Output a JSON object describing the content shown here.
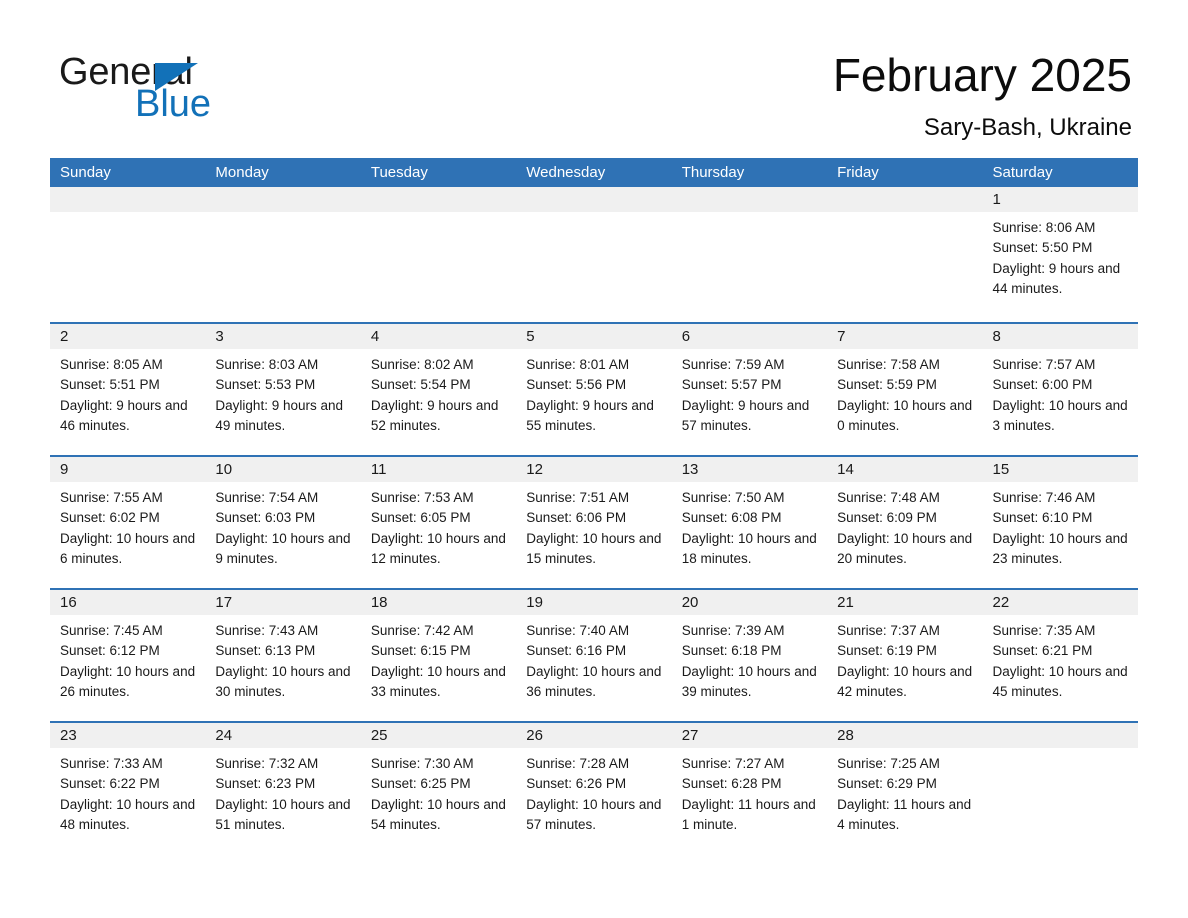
{
  "brand": {
    "name_part1": "General",
    "name_part2": "Blue",
    "accent_color": "#1271b8"
  },
  "header": {
    "month_title": "February 2025",
    "location": "Sary-Bash, Ukraine"
  },
  "calendar": {
    "header_bg_color": "#2f72b5",
    "day_band_color": "#f0f0f0",
    "day_names": [
      "Sunday",
      "Monday",
      "Tuesday",
      "Wednesday",
      "Thursday",
      "Friday",
      "Saturday"
    ],
    "weeks": [
      [
        {
          "day": "",
          "empty": true
        },
        {
          "day": "",
          "empty": true
        },
        {
          "day": "",
          "empty": true
        },
        {
          "day": "",
          "empty": true
        },
        {
          "day": "",
          "empty": true
        },
        {
          "day": "",
          "empty": true
        },
        {
          "day": "1",
          "sunrise": "Sunrise: 8:06 AM",
          "sunset": "Sunset: 5:50 PM",
          "daylight": "Daylight: 9 hours and 44 minutes."
        }
      ],
      [
        {
          "day": "2",
          "sunrise": "Sunrise: 8:05 AM",
          "sunset": "Sunset: 5:51 PM",
          "daylight": "Daylight: 9 hours and 46 minutes."
        },
        {
          "day": "3",
          "sunrise": "Sunrise: 8:03 AM",
          "sunset": "Sunset: 5:53 PM",
          "daylight": "Daylight: 9 hours and 49 minutes."
        },
        {
          "day": "4",
          "sunrise": "Sunrise: 8:02 AM",
          "sunset": "Sunset: 5:54 PM",
          "daylight": "Daylight: 9 hours and 52 minutes."
        },
        {
          "day": "5",
          "sunrise": "Sunrise: 8:01 AM",
          "sunset": "Sunset: 5:56 PM",
          "daylight": "Daylight: 9 hours and 55 minutes."
        },
        {
          "day": "6",
          "sunrise": "Sunrise: 7:59 AM",
          "sunset": "Sunset: 5:57 PM",
          "daylight": "Daylight: 9 hours and 57 minutes."
        },
        {
          "day": "7",
          "sunrise": "Sunrise: 7:58 AM",
          "sunset": "Sunset: 5:59 PM",
          "daylight": "Daylight: 10 hours and 0 minutes."
        },
        {
          "day": "8",
          "sunrise": "Sunrise: 7:57 AM",
          "sunset": "Sunset: 6:00 PM",
          "daylight": "Daylight: 10 hours and 3 minutes."
        }
      ],
      [
        {
          "day": "9",
          "sunrise": "Sunrise: 7:55 AM",
          "sunset": "Sunset: 6:02 PM",
          "daylight": "Daylight: 10 hours and 6 minutes."
        },
        {
          "day": "10",
          "sunrise": "Sunrise: 7:54 AM",
          "sunset": "Sunset: 6:03 PM",
          "daylight": "Daylight: 10 hours and 9 minutes."
        },
        {
          "day": "11",
          "sunrise": "Sunrise: 7:53 AM",
          "sunset": "Sunset: 6:05 PM",
          "daylight": "Daylight: 10 hours and 12 minutes."
        },
        {
          "day": "12",
          "sunrise": "Sunrise: 7:51 AM",
          "sunset": "Sunset: 6:06 PM",
          "daylight": "Daylight: 10 hours and 15 minutes."
        },
        {
          "day": "13",
          "sunrise": "Sunrise: 7:50 AM",
          "sunset": "Sunset: 6:08 PM",
          "daylight": "Daylight: 10 hours and 18 minutes."
        },
        {
          "day": "14",
          "sunrise": "Sunrise: 7:48 AM",
          "sunset": "Sunset: 6:09 PM",
          "daylight": "Daylight: 10 hours and 20 minutes."
        },
        {
          "day": "15",
          "sunrise": "Sunrise: 7:46 AM",
          "sunset": "Sunset: 6:10 PM",
          "daylight": "Daylight: 10 hours and 23 minutes."
        }
      ],
      [
        {
          "day": "16",
          "sunrise": "Sunrise: 7:45 AM",
          "sunset": "Sunset: 6:12 PM",
          "daylight": "Daylight: 10 hours and 26 minutes."
        },
        {
          "day": "17",
          "sunrise": "Sunrise: 7:43 AM",
          "sunset": "Sunset: 6:13 PM",
          "daylight": "Daylight: 10 hours and 30 minutes."
        },
        {
          "day": "18",
          "sunrise": "Sunrise: 7:42 AM",
          "sunset": "Sunset: 6:15 PM",
          "daylight": "Daylight: 10 hours and 33 minutes."
        },
        {
          "day": "19",
          "sunrise": "Sunrise: 7:40 AM",
          "sunset": "Sunset: 6:16 PM",
          "daylight": "Daylight: 10 hours and 36 minutes."
        },
        {
          "day": "20",
          "sunrise": "Sunrise: 7:39 AM",
          "sunset": "Sunset: 6:18 PM",
          "daylight": "Daylight: 10 hours and 39 minutes."
        },
        {
          "day": "21",
          "sunrise": "Sunrise: 7:37 AM",
          "sunset": "Sunset: 6:19 PM",
          "daylight": "Daylight: 10 hours and 42 minutes."
        },
        {
          "day": "22",
          "sunrise": "Sunrise: 7:35 AM",
          "sunset": "Sunset: 6:21 PM",
          "daylight": "Daylight: 10 hours and 45 minutes."
        }
      ],
      [
        {
          "day": "23",
          "sunrise": "Sunrise: 7:33 AM",
          "sunset": "Sunset: 6:22 PM",
          "daylight": "Daylight: 10 hours and 48 minutes."
        },
        {
          "day": "24",
          "sunrise": "Sunrise: 7:32 AM",
          "sunset": "Sunset: 6:23 PM",
          "daylight": "Daylight: 10 hours and 51 minutes."
        },
        {
          "day": "25",
          "sunrise": "Sunrise: 7:30 AM",
          "sunset": "Sunset: 6:25 PM",
          "daylight": "Daylight: 10 hours and 54 minutes."
        },
        {
          "day": "26",
          "sunrise": "Sunrise: 7:28 AM",
          "sunset": "Sunset: 6:26 PM",
          "daylight": "Daylight: 10 hours and 57 minutes."
        },
        {
          "day": "27",
          "sunrise": "Sunrise: 7:27 AM",
          "sunset": "Sunset: 6:28 PM",
          "daylight": "Daylight: 11 hours and 1 minute."
        },
        {
          "day": "28",
          "sunrise": "Sunrise: 7:25 AM",
          "sunset": "Sunset: 6:29 PM",
          "daylight": "Daylight: 11 hours and 4 minutes."
        },
        {
          "day": "",
          "empty": true
        }
      ]
    ]
  }
}
